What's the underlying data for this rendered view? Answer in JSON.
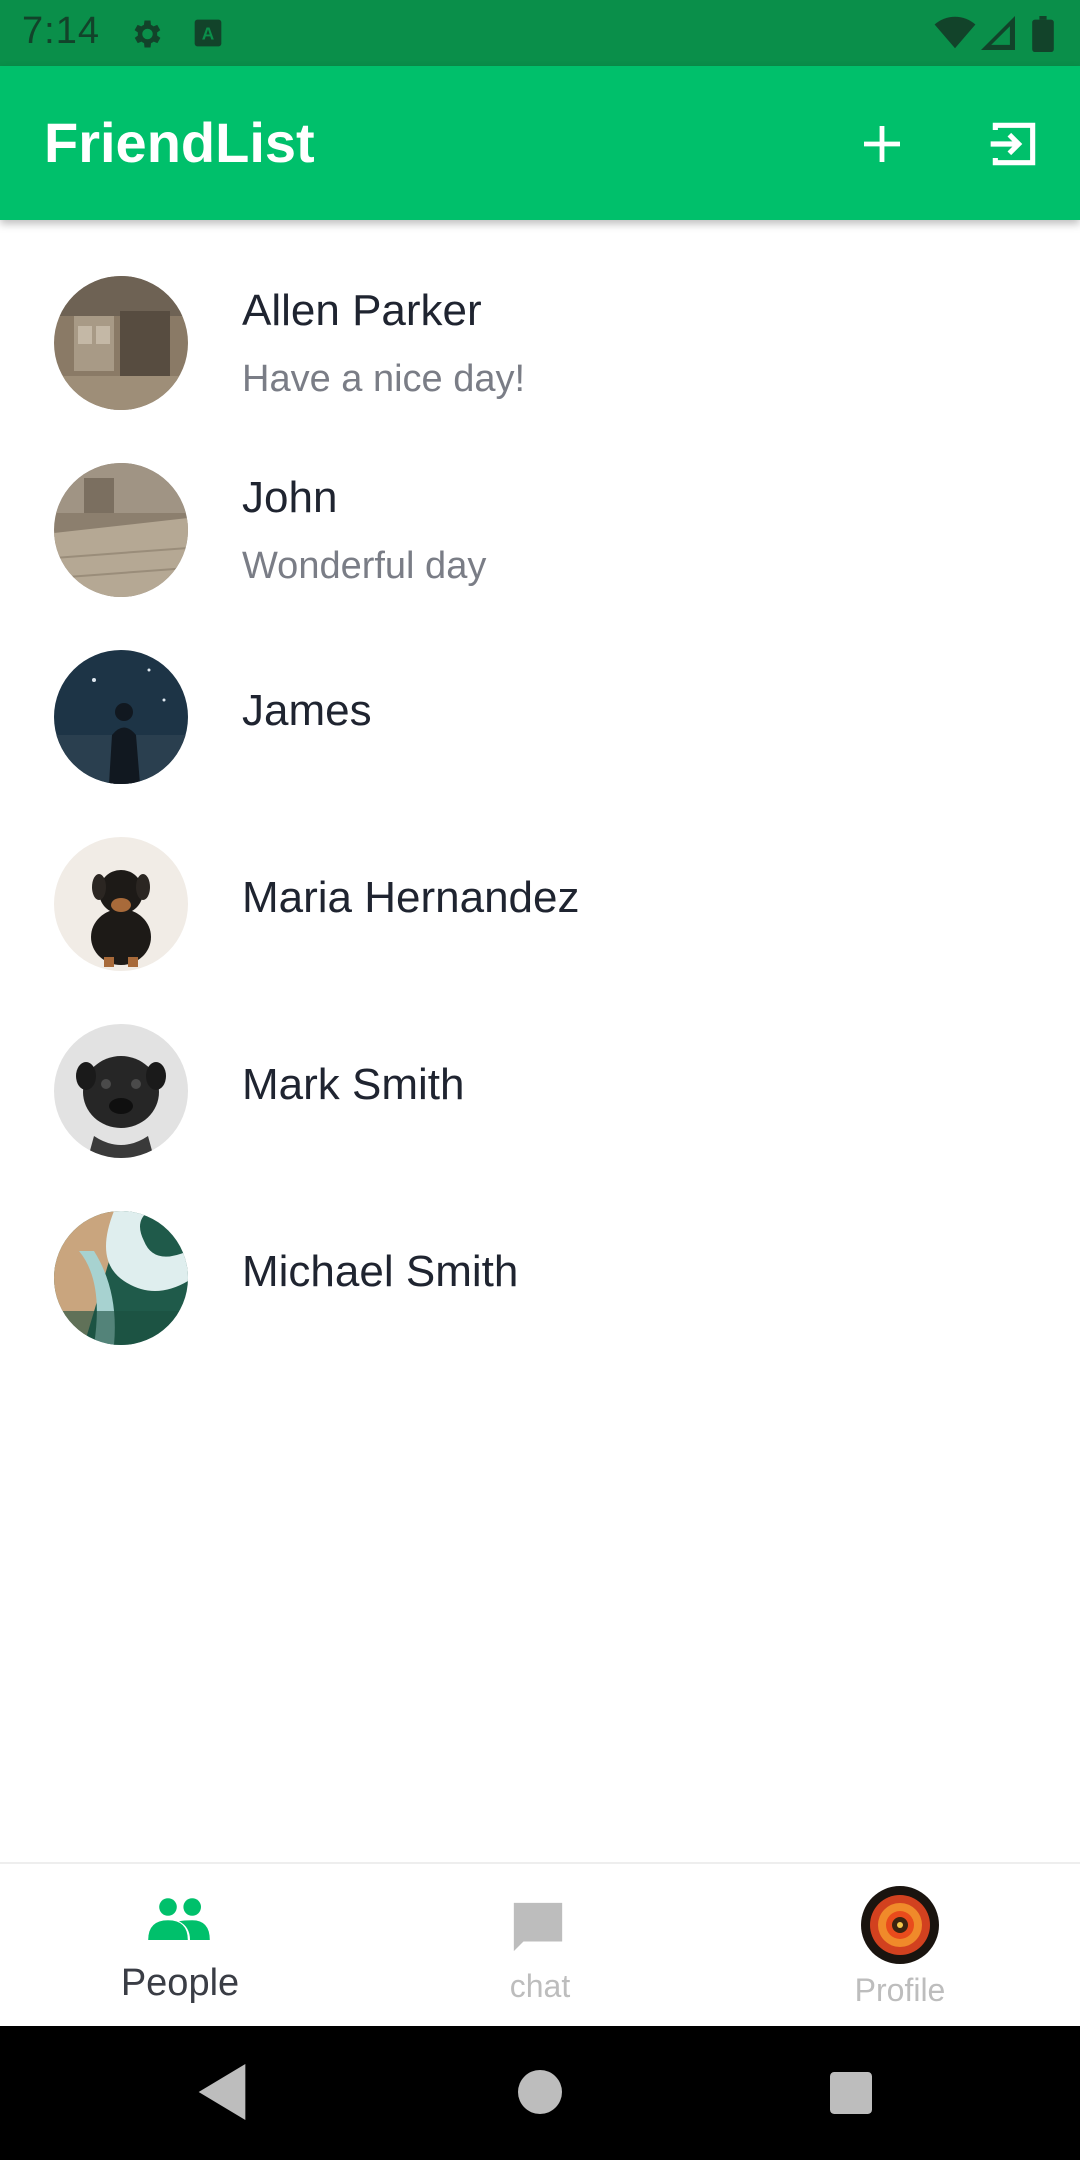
{
  "status_bar": {
    "time": "7:14",
    "icons": [
      "gear-icon",
      "keyboard-icon",
      "wifi-icon",
      "signal-icon",
      "battery-icon"
    ]
  },
  "app_bar": {
    "title": "FriendList",
    "actions": [
      "add-icon",
      "logout-icon"
    ],
    "color": "#00c06b"
  },
  "friends": [
    {
      "name": "Allen Parker",
      "status": "Have a nice day!"
    },
    {
      "name": "John",
      "status": "Wonderful day"
    },
    {
      "name": "James",
      "status": ""
    },
    {
      "name": "Maria Hernandez",
      "status": ""
    },
    {
      "name": "Mark Smith",
      "status": ""
    },
    {
      "name": "Michael Smith",
      "status": ""
    }
  ],
  "bottom_nav": {
    "items": [
      {
        "label": "People",
        "icon": "people-icon",
        "active": true
      },
      {
        "label": "chat",
        "icon": "chat-bubble-icon",
        "active": false
      },
      {
        "label": "Profile",
        "icon": "profile-avatar",
        "active": false
      }
    ],
    "active_color": "#00c06b",
    "inactive_color": "#bdbdbd"
  },
  "system_nav": [
    "back-icon",
    "home-icon",
    "recents-icon"
  ]
}
